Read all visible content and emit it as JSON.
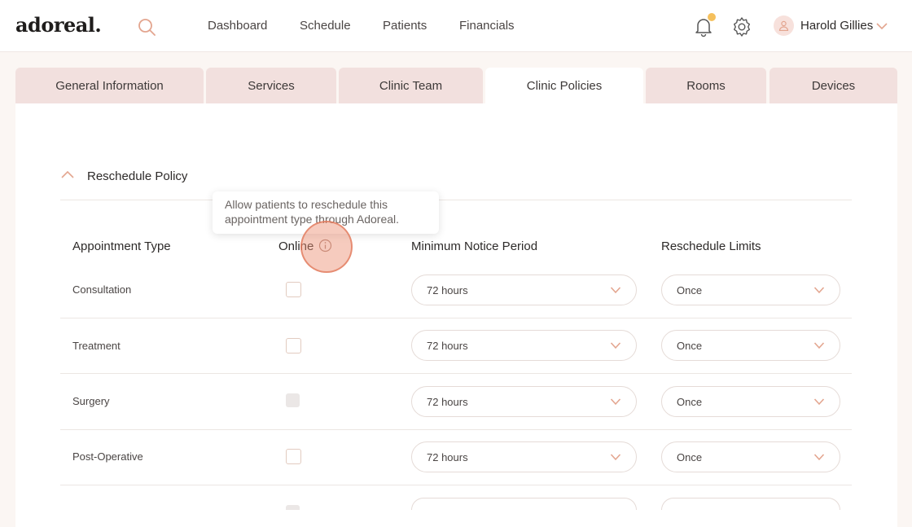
{
  "brand": {
    "logo": "adoreal."
  },
  "nav": {
    "links": [
      "Dashboard",
      "Schedule",
      "Patients",
      "Financials"
    ]
  },
  "user": {
    "name": "Harold Gillies"
  },
  "tabs": [
    "General Information",
    "Services",
    "Clinic Team",
    "Clinic Policies",
    "Rooms",
    "Devices"
  ],
  "active_tab": "Clinic Policies",
  "section": {
    "title": "Reschedule Policy"
  },
  "columns": {
    "type": "Appointment Type",
    "online": "Online",
    "notice": "Minimum Notice Period",
    "limits": "Reschedule Limits"
  },
  "tooltip": {
    "line1": "Allow patients to reschedule this",
    "line2": "appointment type through Adoreal."
  },
  "rows": [
    {
      "type": "Consultation",
      "notice": "72 hours",
      "limit": "Once"
    },
    {
      "type": "Treatment",
      "notice": "72 hours",
      "limit": "Once"
    },
    {
      "type": "Surgery",
      "notice": "72 hours",
      "limit": "Once"
    },
    {
      "type": "Post-Operative",
      "notice": "72 hours",
      "limit": "Once"
    }
  ],
  "colors": {
    "accent": "#e3a58f",
    "tab_bg": "#f2e0de",
    "notification_dot": "#f5c05c"
  }
}
